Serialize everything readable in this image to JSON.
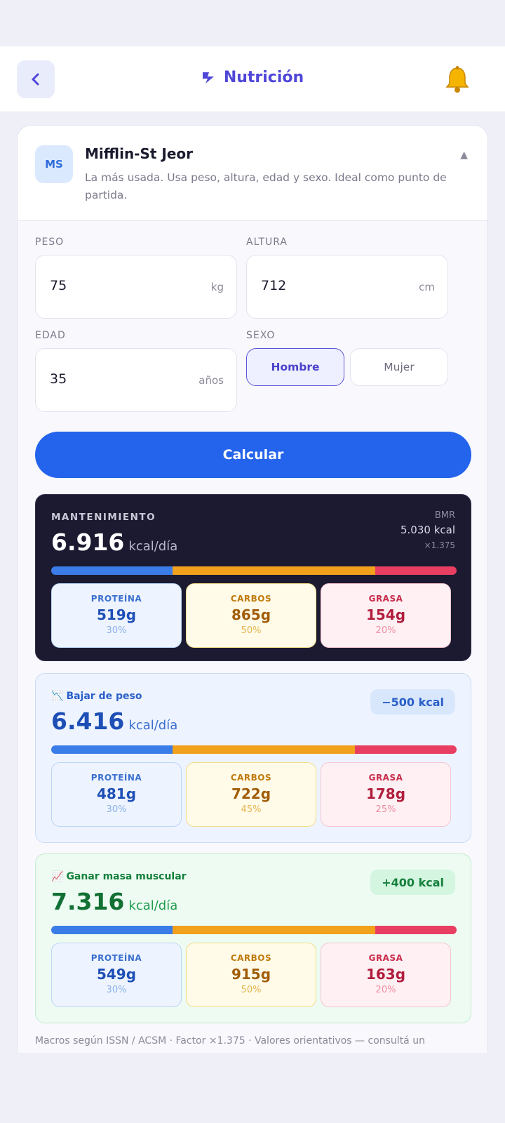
{
  "header": {
    "title": "Nutrición"
  },
  "formula": {
    "badge": "MS",
    "name": "Mifflin-St Jeor",
    "description": "La más usada. Usa peso, altura, edad y sexo. Ideal como punto de partida.",
    "expanded_glyph": "▲"
  },
  "inputs": {
    "peso": {
      "label": "PESO",
      "value": "75",
      "unit": "kg"
    },
    "altura": {
      "label": "ALTURA",
      "value": "712",
      "unit": "cm"
    },
    "edad": {
      "label": "EDAD",
      "value": "35",
      "unit": "años"
    },
    "sexo": {
      "label": "SEXO",
      "options": [
        "Hombre",
        "Mujer"
      ],
      "selected": "Hombre"
    }
  },
  "calculate_label": "Calcular",
  "maintenance": {
    "label": "MANTENIMIENTO",
    "kcal": "6.916",
    "unit": "kcal/día",
    "bmr_label": "BMR",
    "bmr_value": "5.030 kcal",
    "factor": "×1.375",
    "macros": [
      {
        "name": "PROTEÍNA",
        "grams": "519g",
        "pct": "30%",
        "fraction": 0.3
      },
      {
        "name": "CARBOS",
        "grams": "865g",
        "pct": "50%",
        "fraction": 0.5
      },
      {
        "name": "GRASA",
        "grams": "154g",
        "pct": "20%",
        "fraction": 0.2
      }
    ]
  },
  "lose": {
    "icon": "📉",
    "label": "Bajar de peso",
    "kcal": "6.416",
    "unit": "kcal/día",
    "delta": "−500 kcal",
    "colors": {
      "accent": "#2a5fc9",
      "badge_bg": "#d9e7fc"
    },
    "macros": [
      {
        "name": "PROTEÍNA",
        "grams": "481g",
        "pct": "30%",
        "fraction": 0.3
      },
      {
        "name": "CARBOS",
        "grams": "722g",
        "pct": "45%",
        "fraction": 0.45
      },
      {
        "name": "GRASA",
        "grams": "178g",
        "pct": "25%",
        "fraction": 0.25
      }
    ]
  },
  "gain": {
    "icon": "📈",
    "label": "Ganar masa muscular",
    "kcal": "7.316",
    "unit": "kcal/día",
    "delta": "+400 kcal",
    "colors": {
      "accent": "#16803c",
      "badge_bg": "#d4f5e0"
    },
    "macros": [
      {
        "name": "PROTEÍNA",
        "grams": "549g",
        "pct": "30%",
        "fraction": 0.3
      },
      {
        "name": "CARBOS",
        "grams": "915g",
        "pct": "50%",
        "fraction": 0.5
      },
      {
        "name": "GRASA",
        "grams": "163g",
        "pct": "20%",
        "fraction": 0.2
      }
    ]
  },
  "footnote": "Macros según ISSN / ACSM · Factor ×1.375 · Valores orientativos — consultá un"
}
